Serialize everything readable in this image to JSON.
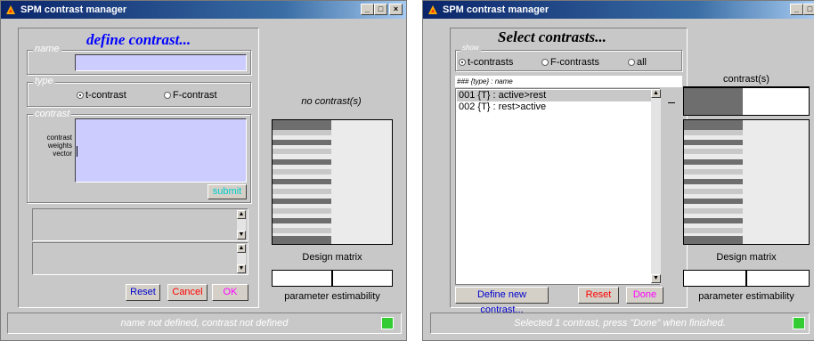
{
  "left_window": {
    "title": "SPM contrast manager",
    "heading": "define contrast...",
    "name_group": "name",
    "name_value": "",
    "type_group": "type",
    "radio_t": "t-contrast",
    "radio_f": "F-contrast",
    "contrast_group": "contrast",
    "weights_label_1": "contrast",
    "weights_label_2": "weights",
    "weights_label_3": "vector",
    "submit_label": "submit",
    "reset": "Reset",
    "cancel": "Cancel",
    "ok": "OK",
    "no_contrast": "no contrast(s)",
    "design_matrix": "Design matrix",
    "param_estimability": "parameter estimability",
    "status": "name not defined, contrast not defined"
  },
  "right_window": {
    "title": "SPM contrast manager",
    "heading": "Select contrasts...",
    "show_group": "show",
    "radio_t": "t-contrasts",
    "radio_f": "F-contrasts",
    "radio_all": "all",
    "list_header": "### {type} : name",
    "contrasts": [
      "001 {T} : active>rest",
      "002 {T} : rest>active"
    ],
    "contrasts_label": "contrast(s)",
    "define_new": "Define new contrast...",
    "reset": "Reset",
    "done": "Done",
    "design_matrix": "Design matrix",
    "param_estimability": "parameter estimability",
    "status": "Selected 1 contrast, press \"Done\" when finished."
  },
  "colors": {
    "title_start": "#0a246a",
    "window_bg": "#c8c8c8",
    "input_bg": "#ccccff",
    "heading_blue": "#0000ff",
    "reset_blue": "#0000cc",
    "cancel_red": "#ff0000",
    "ok_magenta": "#ff00ff"
  }
}
